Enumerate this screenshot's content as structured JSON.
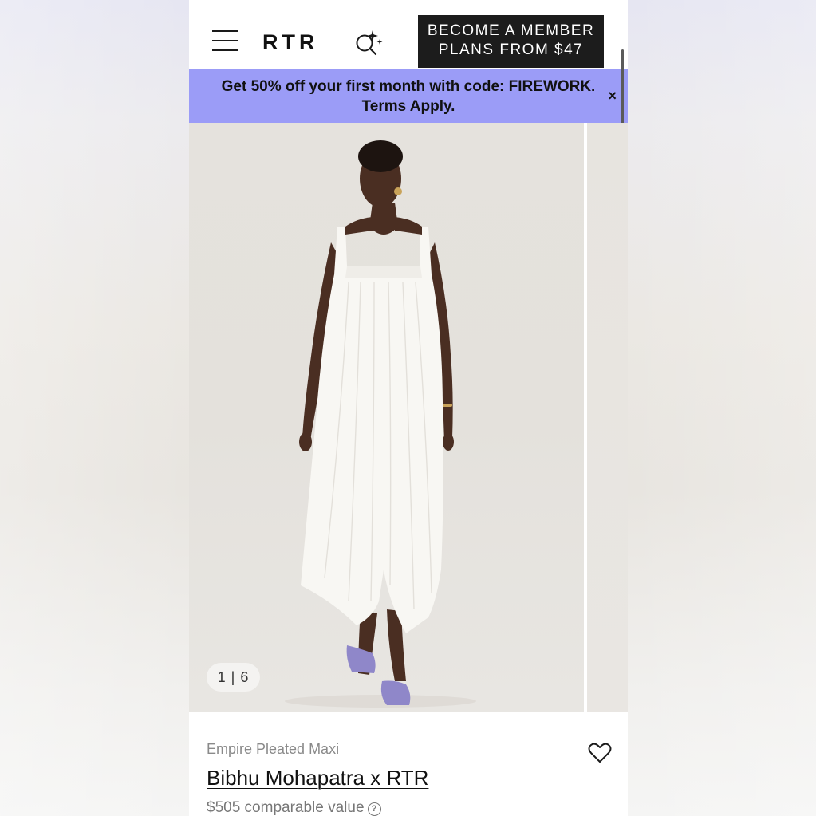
{
  "header": {
    "logo": "RTR",
    "cta_line1": "BECOME A MEMBER",
    "cta_line2": "PLANS FROM $47",
    "icons": {
      "menu": "hamburger-icon",
      "search": "search-sparkle-icon"
    }
  },
  "promo": {
    "text": "Get 50% off your first month with code: FIREWORK.",
    "link": "Terms Apply.",
    "close": "×",
    "background": "#9b9cf7"
  },
  "gallery": {
    "counter": "1 | 6",
    "current": 1,
    "total": 6
  },
  "product": {
    "name": "Empire Pleated Maxi",
    "brand": "Bibhu Mohapatra x RTR",
    "price": "$505 comparable value",
    "help_icon": "?",
    "favorite_icon": "heart-icon"
  }
}
